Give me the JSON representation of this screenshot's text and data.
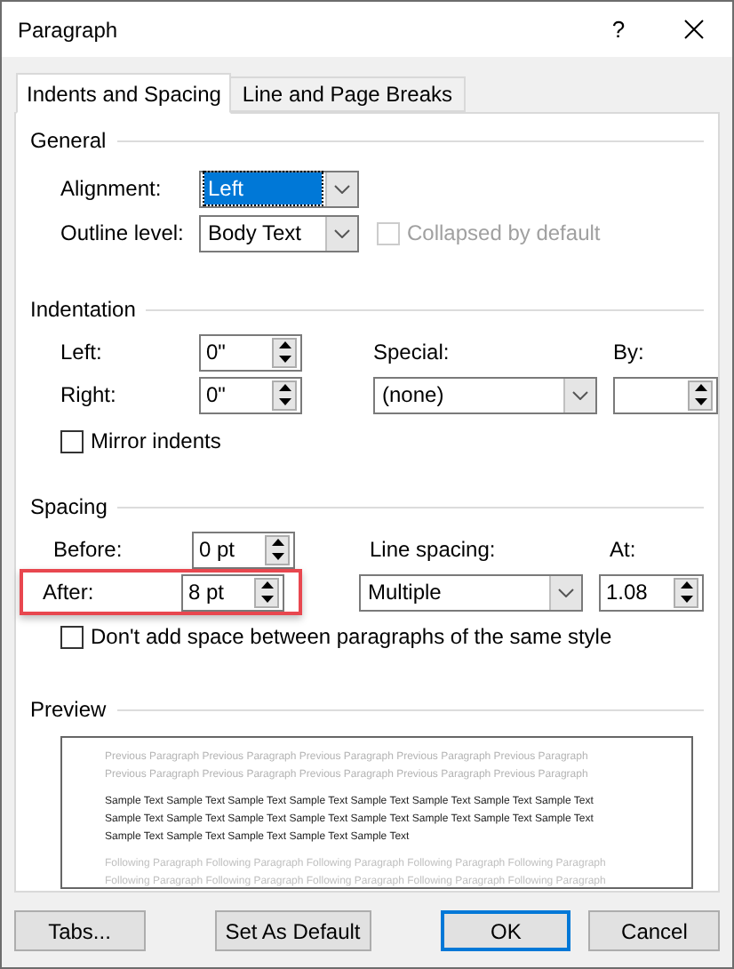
{
  "window": {
    "title": "Paragraph",
    "help": "?"
  },
  "tabs": [
    {
      "label": "Indents and Spacing",
      "selected": true
    },
    {
      "label": "Line and Page Breaks",
      "selected": false
    }
  ],
  "general": {
    "heading": "General",
    "alignment": {
      "label": "Alignment:",
      "value": "Left",
      "focused": true
    },
    "outline_level": {
      "label": "Outline level:",
      "value": "Body Text",
      "focused": false
    },
    "collapsed": {
      "label": "Collapsed by default",
      "checked": false,
      "disabled": true
    }
  },
  "indentation": {
    "heading": "Indentation",
    "left": {
      "label": "Left:",
      "value": "0\""
    },
    "right": {
      "label": "Right:",
      "value": "0\""
    },
    "special": {
      "label": "Special:",
      "value": "(none)"
    },
    "by": {
      "label": "By:"
    },
    "mirror": {
      "label": "Mirror indents",
      "checked": false,
      "disabled": false
    }
  },
  "spacing": {
    "heading": "Spacing",
    "before": {
      "label": "Before:",
      "value": "0 pt",
      "highlighted": false
    },
    "after": {
      "label": "After:",
      "value": "8 pt",
      "highlighted": true
    },
    "line_spacing": {
      "label": "Line spacing:",
      "value": "Multiple"
    },
    "at": {
      "label": "At:",
      "value": "1.08"
    },
    "dont_add": {
      "label": "Don't add space between paragraphs of the same style",
      "checked": false,
      "disabled": false
    }
  },
  "preview": {
    "heading": "Preview",
    "lines": [
      {
        "kind": "previous",
        "text": "Previous Paragraph Previous Paragraph Previous Paragraph Previous Paragraph Previous Paragraph"
      },
      {
        "kind": "previous",
        "text": "Previous Paragraph Previous Paragraph Previous Paragraph Previous Paragraph Previous Paragraph"
      },
      {
        "kind": "sample",
        "text": "Sample Text Sample Text Sample Text Sample Text Sample Text Sample Text Sample Text Sample Text"
      },
      {
        "kind": "sample",
        "text": "Sample Text Sample Text Sample Text Sample Text Sample Text Sample Text Sample Text Sample Text"
      },
      {
        "kind": "sample",
        "text": "Sample Text Sample Text Sample Text Sample Text Sample Text"
      },
      {
        "kind": "following",
        "text": "Following Paragraph Following Paragraph Following Paragraph Following Paragraph Following Paragraph"
      },
      {
        "kind": "following",
        "text": "Following Paragraph Following Paragraph Following Paragraph Following Paragraph Following Paragraph"
      }
    ]
  },
  "buttons": [
    {
      "label": "Tabs...",
      "default": false
    },
    {
      "label": "Set As Default",
      "default": false
    },
    {
      "label": "OK",
      "default": true
    },
    {
      "label": "Cancel",
      "default": false
    }
  ]
}
